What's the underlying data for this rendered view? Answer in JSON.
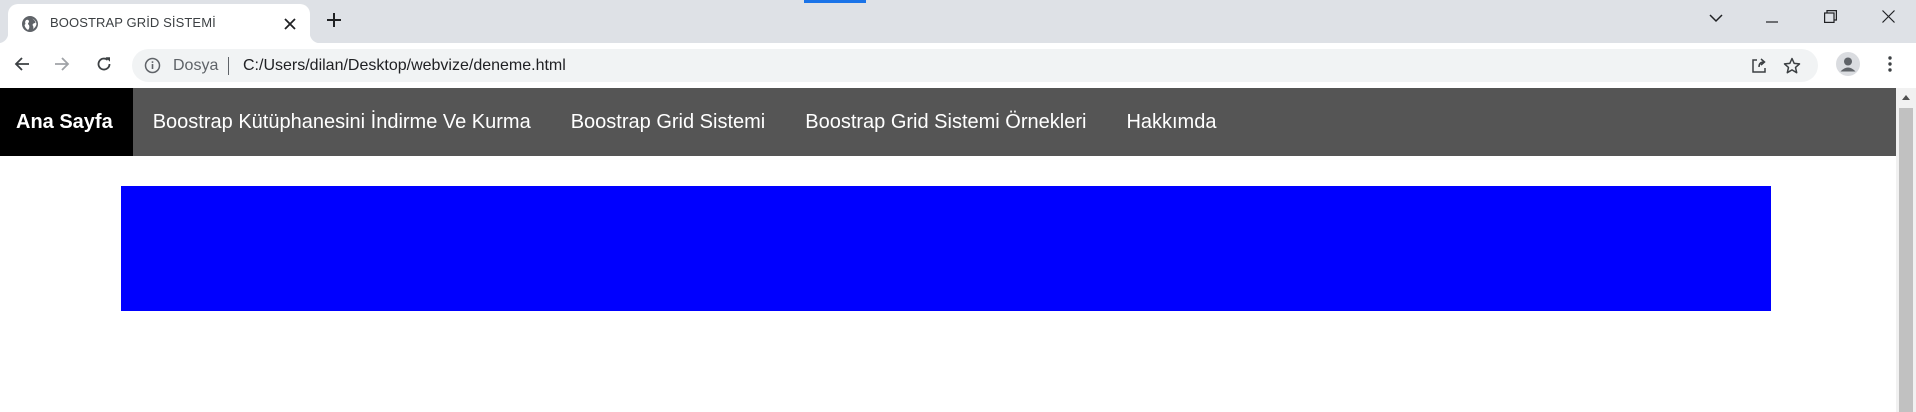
{
  "browser": {
    "tab": {
      "title": "BOOSTRAP GRİD SİSTEMİ",
      "favicon": "globe-icon",
      "close_icon": "close-icon"
    },
    "new_tab_icon": "plus-icon",
    "window_controls": [
      "chevron-down-icon",
      "minimize-icon",
      "restore-icon",
      "close-icon"
    ],
    "toolbar": {
      "back_icon": "arrow-left-icon",
      "forward_icon": "arrow-right-icon",
      "reload_icon": "reload-icon",
      "address": {
        "security_label": "Dosya",
        "url": "C:/Users/dilan/Desktop/webvize/deneme.html"
      },
      "right_icons": [
        "share-icon",
        "star-icon",
        "profile-icon",
        "kebab-menu-icon"
      ]
    }
  },
  "page": {
    "navbar": {
      "background": "#555555",
      "active_background": "#000000",
      "items": [
        {
          "label": "Ana Sayfa",
          "active": true
        },
        {
          "label": "Boostrap Kütüphanesini İndirme Ve Kurma",
          "active": false
        },
        {
          "label": "Boostrap Grid Sistemi",
          "active": false
        },
        {
          "label": "Boostrap Grid Sistemi Örnekleri",
          "active": false
        },
        {
          "label": "Hakkımda",
          "active": false
        }
      ]
    },
    "content_box_color": "#0000ff"
  }
}
